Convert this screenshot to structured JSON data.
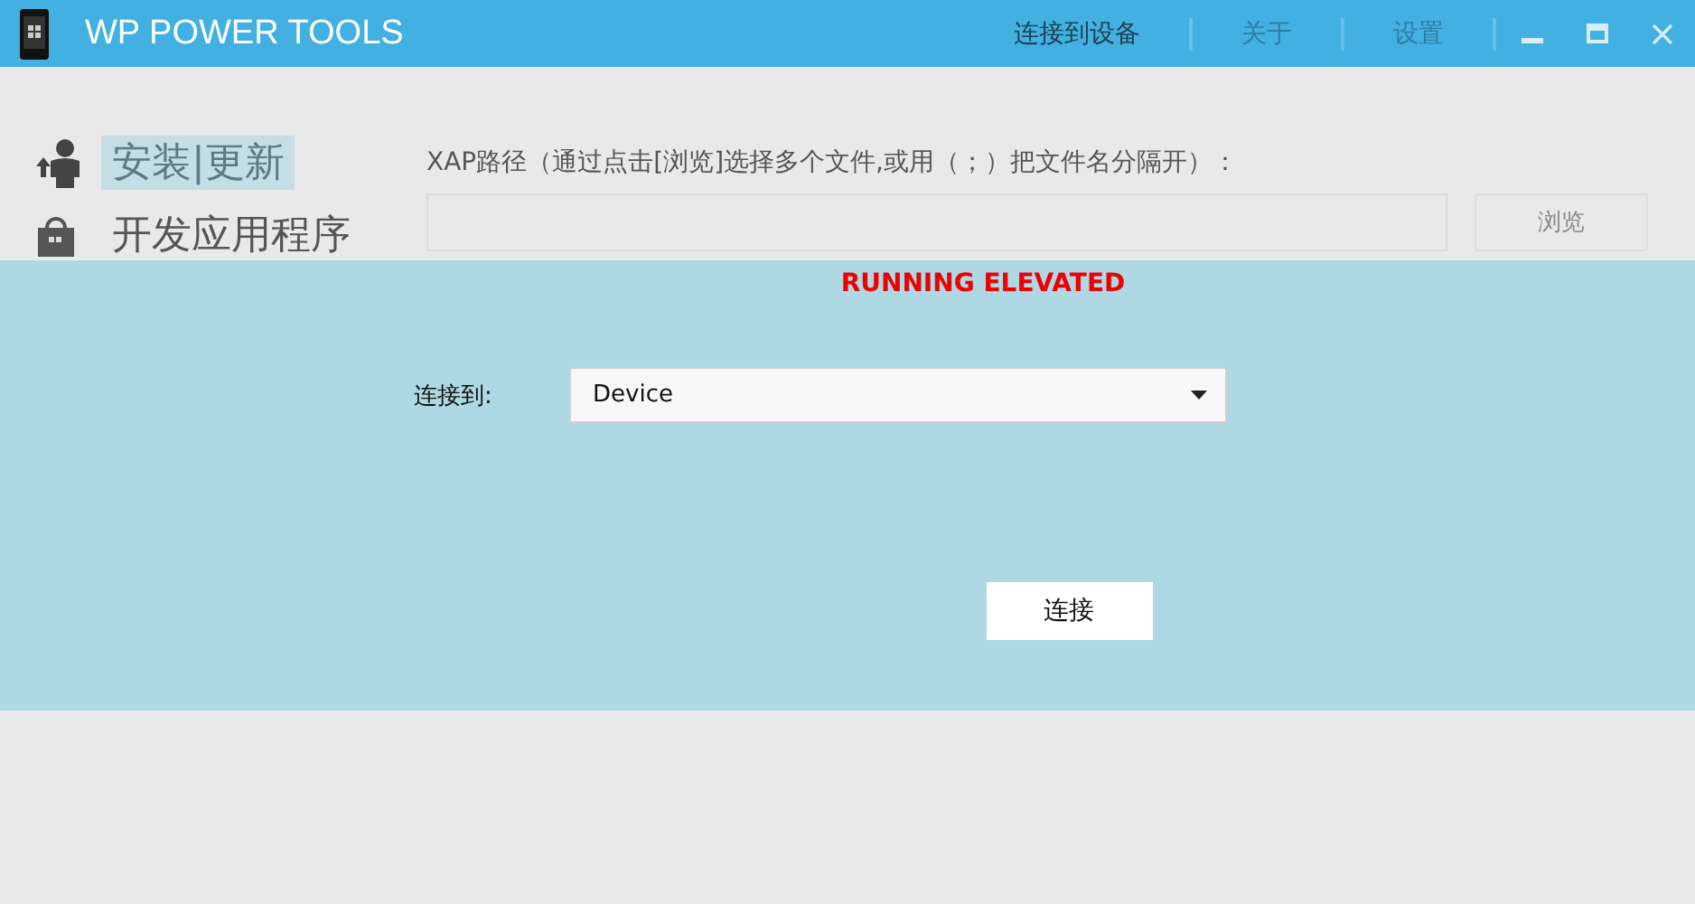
{
  "window": {
    "title": "WP POWER TOOLS"
  },
  "menu": [
    {
      "label": "连接到设备",
      "selected": true
    },
    {
      "label": "关于",
      "selected": false
    },
    {
      "label": "设置",
      "selected": false
    }
  ],
  "sidebar": {
    "items": [
      {
        "label": "安装|更新",
        "kind": "install",
        "selected": true
      },
      {
        "label": "开发应用程序",
        "kind": "develop",
        "selected": false
      }
    ]
  },
  "xap": {
    "label": "XAP路径（通过点击[浏览]选择多个文件,或用（；）把文件名分隔开）：",
    "browse_button": {
      "label": "浏览",
      "disabled": true
    }
  },
  "dialog": {
    "status": "RUNNING ELEVATED",
    "connect_label": "连接到:",
    "device": {
      "value": "Device"
    },
    "connect_button": "连接"
  }
}
